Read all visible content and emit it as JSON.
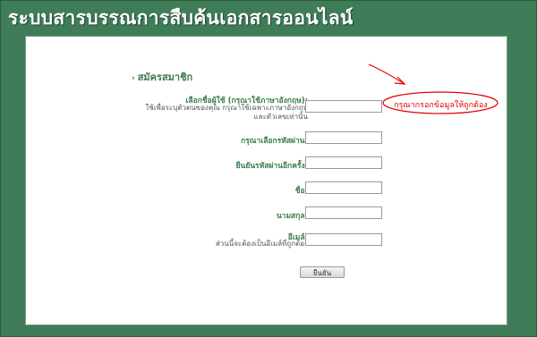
{
  "header": {
    "title": "ระบบสารบรรณการสืบค้นเอกสารออนไลน์"
  },
  "form": {
    "section_title": "สมัครสมาชิก",
    "username": {
      "label": "เลือกชื่อผู้ใช้ (กรุณาใช้ภาษาอังกฤษ):",
      "hint_line1": "ใช้เพื่อระบุตัวตนของคุณ กรุณาใช้เฉพาะภาษาอังกฤษ",
      "hint_line2": "และตัวเลขเท่านั้น",
      "value": ""
    },
    "password": {
      "label": "กรุณาเลือกรหัสผ่าน:",
      "value": ""
    },
    "confirm_password": {
      "label": "ยืนยันรหัสผ่านอีกครั้ง:",
      "value": ""
    },
    "first_name": {
      "label": "ชื่อ:",
      "value": ""
    },
    "last_name": {
      "label": "นามสกุล:",
      "value": ""
    },
    "email": {
      "label": "อีเมล์:",
      "hint": "ส่วนนี้จะต้องเป็นอีเมล์ที่ถูกต้อง",
      "value": ""
    },
    "submit_label": "ยืนยัน"
  },
  "annotation": {
    "text": "กรุณากรอกข้อมูลให้ถูกต้อง",
    "color": "#e00000"
  },
  "colors": {
    "background": "#3f7c58",
    "label_green": "#3b7a4c"
  }
}
